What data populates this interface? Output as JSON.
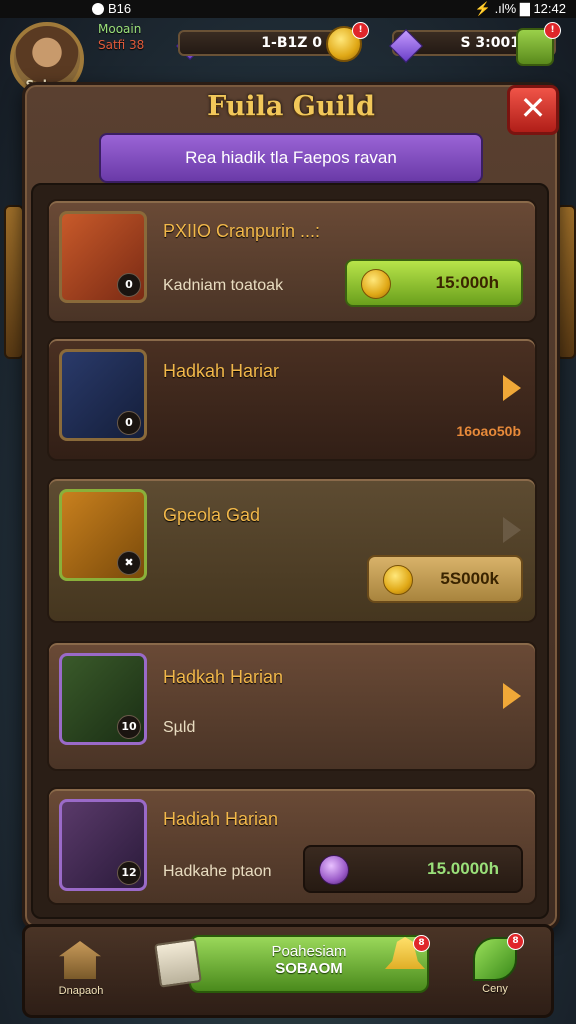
{
  "status_bar": {
    "left": "B16",
    "right": "⚡ .ıl% ▇ 12:42"
  },
  "player": {
    "name": "Mooain",
    "subtitle": "Satfi 38",
    "avatar_label": "Subaun"
  },
  "resources": [
    {
      "value": "1-B1Z 0",
      "icon": "gold-coin-icon"
    },
    {
      "value": "S 3:001",
      "icon": "purple-gem-icon"
    }
  ],
  "badges": {
    "coin": "!",
    "plus": "!",
    "bell": "8",
    "leaf": "8"
  },
  "panel": {
    "title": "Fuila Guild",
    "close_label": "✕",
    "banner": "Rea hiadik tla Faepos ravan"
  },
  "items": [
    {
      "title": "PXIIO Cranpurin ...:",
      "subtitle": "Kadniam toatoak",
      "price": "15:000h",
      "count": "0",
      "price_style": "green",
      "icon": "treasure-chest-icon"
    },
    {
      "title": "Hadkah Hariar",
      "subtitle": "",
      "price": "",
      "value_text": "16oao50b",
      "count": "0",
      "icon": "crystal-spear-icon"
    },
    {
      "title": "Gpeola Gad",
      "subtitle": "",
      "price": "5S000k",
      "count": "✖",
      "price_style": "tan",
      "icon": "scroll-icon"
    },
    {
      "title": "Hadkah Harian",
      "subtitle": "Sµld",
      "price": "",
      "count": "10",
      "icon": "emerald-sword-icon"
    },
    {
      "title": "Hadiah Harian",
      "subtitle": "Hadkahe ptaon",
      "price": "15.0000h",
      "count": "12",
      "price_style": "darkbox",
      "icon": "golden-staff-icon"
    }
  ],
  "bottom_bar": {
    "left_label": "Dnapaoh",
    "main_button_line1": "Poahesiam",
    "main_button_line2": "SOBAOM",
    "right_label": "Ceny"
  },
  "colors": {
    "title_gold": "#f2c85a",
    "banner_purple": "#8a54c8",
    "close_red": "#d8342c",
    "action_green": "#8ac83a"
  }
}
